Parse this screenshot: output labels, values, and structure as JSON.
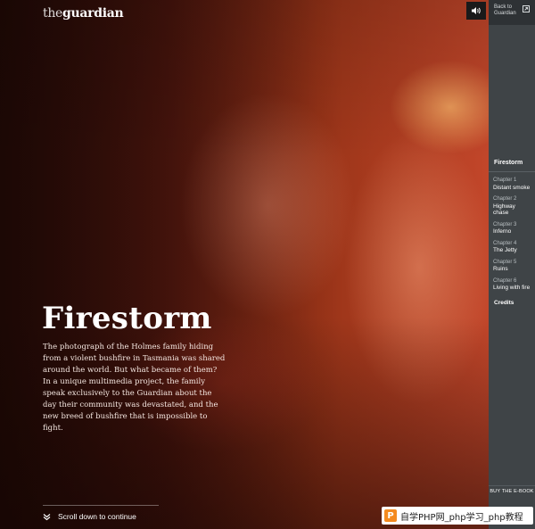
{
  "header": {
    "logo_the": "the",
    "logo_name": "guardian",
    "sound_icon": "speaker-icon"
  },
  "hero": {
    "title": "Firestorm",
    "intro": "The photograph of the Holmes family hiding from a violent bushfire in Tasmania was shared around the world. But what became of them? In a unique multimedia project, the family speak exclusively to the Guardian about the day their community was devastated, and the new breed of bushfire that is impossible to fight.",
    "scroll_label": "Scroll down to continue",
    "scroll_icon": "double-chevron-down-icon"
  },
  "sidebar": {
    "back_label": "Back to Guardian",
    "back_icon": "external-link-icon",
    "current": "Firestorm",
    "chapters": [
      {
        "num": "Chapter 1",
        "name": "Distant smoke"
      },
      {
        "num": "Chapter 2",
        "name": "Highway chase"
      },
      {
        "num": "Chapter 3",
        "name": "Inferno"
      },
      {
        "num": "Chapter 4",
        "name": "The Jetty"
      },
      {
        "num": "Chapter 5",
        "name": "Ruins"
      },
      {
        "num": "Chapter 6",
        "name": "Living with fire"
      }
    ],
    "credits": "Credits",
    "buy_label": "BUY THE E-BOOK"
  },
  "watermark": {
    "text": "自学PHP网_php学习_php教程"
  },
  "colors": {
    "sidebar_bg": "#3f4447",
    "hero_accent": "#c2462a",
    "text_light": "#ffffff"
  }
}
